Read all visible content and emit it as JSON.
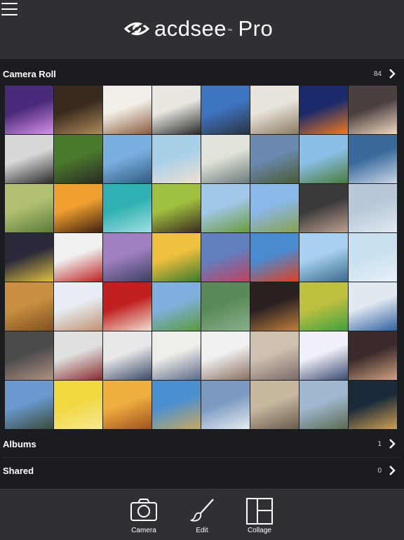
{
  "app": {
    "brand": "acdsee",
    "edition": "Pro",
    "trademark": "™"
  },
  "camera_roll": {
    "label": "Camera Roll",
    "count": "84"
  },
  "albums": {
    "label": "Albums",
    "count": "1"
  },
  "shared": {
    "label": "Shared",
    "count": "0"
  },
  "toolbar": {
    "camera": "Camera",
    "edit": "Edit",
    "collage": "Collage"
  },
  "photos": [
    {
      "name": "concert-crowd",
      "colors": [
        "#4a2a7a",
        "#d990e8"
      ]
    },
    {
      "name": "woman-reading-tablet",
      "colors": [
        "#3a2a1e",
        "#b08a5a"
      ]
    },
    {
      "name": "sailboats",
      "colors": [
        "#f2efe8",
        "#8b5a3a"
      ]
    },
    {
      "name": "woman-with-camera",
      "colors": [
        "#e9e7e0",
        "#2a2a2a"
      ]
    },
    {
      "name": "hiker-on-rocks",
      "colors": [
        "#3f74c2",
        "#2a3440"
      ]
    },
    {
      "name": "man-at-laptop",
      "colors": [
        "#e8e4dc",
        "#8a7a60"
      ]
    },
    {
      "name": "night-light-trails",
      "colors": [
        "#1a2a6a",
        "#f07a20"
      ]
    },
    {
      "name": "highway-light-streaks",
      "colors": [
        "#4a4040",
        "#f2d8c0"
      ]
    },
    {
      "name": "woman-camera-bw",
      "colors": [
        "#d8d8d8",
        "#2a2a2a"
      ]
    },
    {
      "name": "photographer-grass",
      "colors": [
        "#4a7a2a",
        "#2a2a2a"
      ]
    },
    {
      "name": "eiffel-tower",
      "colors": [
        "#7ab0e0",
        "#305a80"
      ]
    },
    {
      "name": "couple-selfie",
      "colors": [
        "#a8d0e8",
        "#f0e0d0"
      ]
    },
    {
      "name": "photographer-sky",
      "colors": [
        "#e0e4d8",
        "#6a7a7a"
      ]
    },
    {
      "name": "cyclist-hill",
      "colors": [
        "#6a8ab0",
        "#4a5a30"
      ]
    },
    {
      "name": "cyclist-road",
      "colors": [
        "#8ac0e8",
        "#4a7a3a"
      ]
    },
    {
      "name": "bmx-rider",
      "colors": [
        "#3a6a9a",
        "#c8d8e8"
      ]
    },
    {
      "name": "green-hills",
      "colors": [
        "#b0c070",
        "#5a7a3a"
      ]
    },
    {
      "name": "sunset-silhouette",
      "colors": [
        "#f0a030",
        "#402010"
      ]
    },
    {
      "name": "palm-tree-sky",
      "colors": [
        "#30b0b0",
        "#a0e0e0"
      ]
    },
    {
      "name": "man-camera-green",
      "colors": [
        "#a0c040",
        "#3a2a20"
      ]
    },
    {
      "name": "cyclist-meadow",
      "colors": [
        "#a0c8e8",
        "#6a9a3a"
      ]
    },
    {
      "name": "mother-child-field",
      "colors": [
        "#8ab8e8",
        "#8aa04a"
      ]
    },
    {
      "name": "lens-closeup",
      "colors": [
        "#3a3a3a",
        "#c0a090"
      ]
    },
    {
      "name": "frosty-tree",
      "colors": [
        "#b8c8d8",
        "#e0e8f0"
      ]
    },
    {
      "name": "city-night",
      "colors": [
        "#2a2a3a",
        "#e0c040"
      ]
    },
    {
      "name": "snow-goggles",
      "colors": [
        "#f0f0f0",
        "#c02020"
      ]
    },
    {
      "name": "pier-sunset",
      "colors": [
        "#a080c0",
        "#3a4060"
      ]
    },
    {
      "name": "sunset-meadow",
      "colors": [
        "#f0c040",
        "#3a7a2a"
      ]
    },
    {
      "name": "mountain-flowers",
      "colors": [
        "#6080c0",
        "#c04060"
      ]
    },
    {
      "name": "hot-air-balloons",
      "colors": [
        "#4a8ad0",
        "#e04020"
      ]
    },
    {
      "name": "mountain-lake",
      "colors": [
        "#a8d0f0",
        "#3a6a8a"
      ]
    },
    {
      "name": "frozen-pier",
      "colors": [
        "#c8e0f0",
        "#e8f0f8"
      ]
    },
    {
      "name": "wood-plank",
      "colors": [
        "#c89040",
        "#805020"
      ]
    },
    {
      "name": "woman-cheering",
      "colors": [
        "#e8eef4",
        "#c09070"
      ]
    },
    {
      "name": "camera-lens-red",
      "colors": [
        "#c02020",
        "#f0e0d0"
      ]
    },
    {
      "name": "page-curl-landscape",
      "colors": [
        "#80b0e0",
        "#5a9a3a"
      ]
    },
    {
      "name": "scattered-icons",
      "colors": [
        "#5a8a5a",
        "#8ab08a"
      ]
    },
    {
      "name": "mixing-console",
      "colors": [
        "#2a2020",
        "#c08040"
      ]
    },
    {
      "name": "pixel-focus",
      "colors": [
        "#c0c040",
        "#40a040"
      ]
    },
    {
      "name": "monitor-display",
      "colors": [
        "#e0e8f0",
        "#3060a0"
      ]
    },
    {
      "name": "woman-laughing",
      "colors": [
        "#4a4a4a",
        "#b09080"
      ]
    },
    {
      "name": "office-meeting",
      "colors": [
        "#e0e0e0",
        "#8a2a2a"
      ]
    },
    {
      "name": "team-at-table",
      "colors": [
        "#e8e8e8",
        "#3a4a6a"
      ]
    },
    {
      "name": "man-at-desk",
      "colors": [
        "#f0eee8",
        "#5a6a8a"
      ]
    },
    {
      "name": "group-laptop",
      "colors": [
        "#f0f0f0",
        "#8a7060"
      ]
    },
    {
      "name": "friends-on-couch",
      "colors": [
        "#d0c0b0",
        "#7a6a6a"
      ]
    },
    {
      "name": "sun-rays-valley",
      "colors": [
        "#f0f0f8",
        "#3a4a70"
      ]
    },
    {
      "name": "man-with-camera",
      "colors": [
        "#3a2a2a",
        "#d0a080"
      ]
    },
    {
      "name": "coastline",
      "colors": [
        "#6a9ad0",
        "#3a4a3a"
      ]
    },
    {
      "name": "golden-oil",
      "colors": [
        "#f0d840",
        "#f8e890"
      ]
    },
    {
      "name": "sunset-field",
      "colors": [
        "#f0b040",
        "#a05020"
      ]
    },
    {
      "name": "wheat-field",
      "colors": [
        "#4a90d0",
        "#c8a860"
      ]
    },
    {
      "name": "cloudy-sky",
      "colors": [
        "#7a9ac0",
        "#e8ecf0"
      ]
    },
    {
      "name": "oil-pumps-sepia",
      "colors": [
        "#c8b8a0",
        "#6a5a4a"
      ]
    },
    {
      "name": "pump-jack-sky",
      "colors": [
        "#a0b8d0",
        "#5a6a50"
      ]
    },
    {
      "name": "city-lights-bokeh",
      "colors": [
        "#1a2a3a",
        "#d0a050"
      ]
    }
  ]
}
